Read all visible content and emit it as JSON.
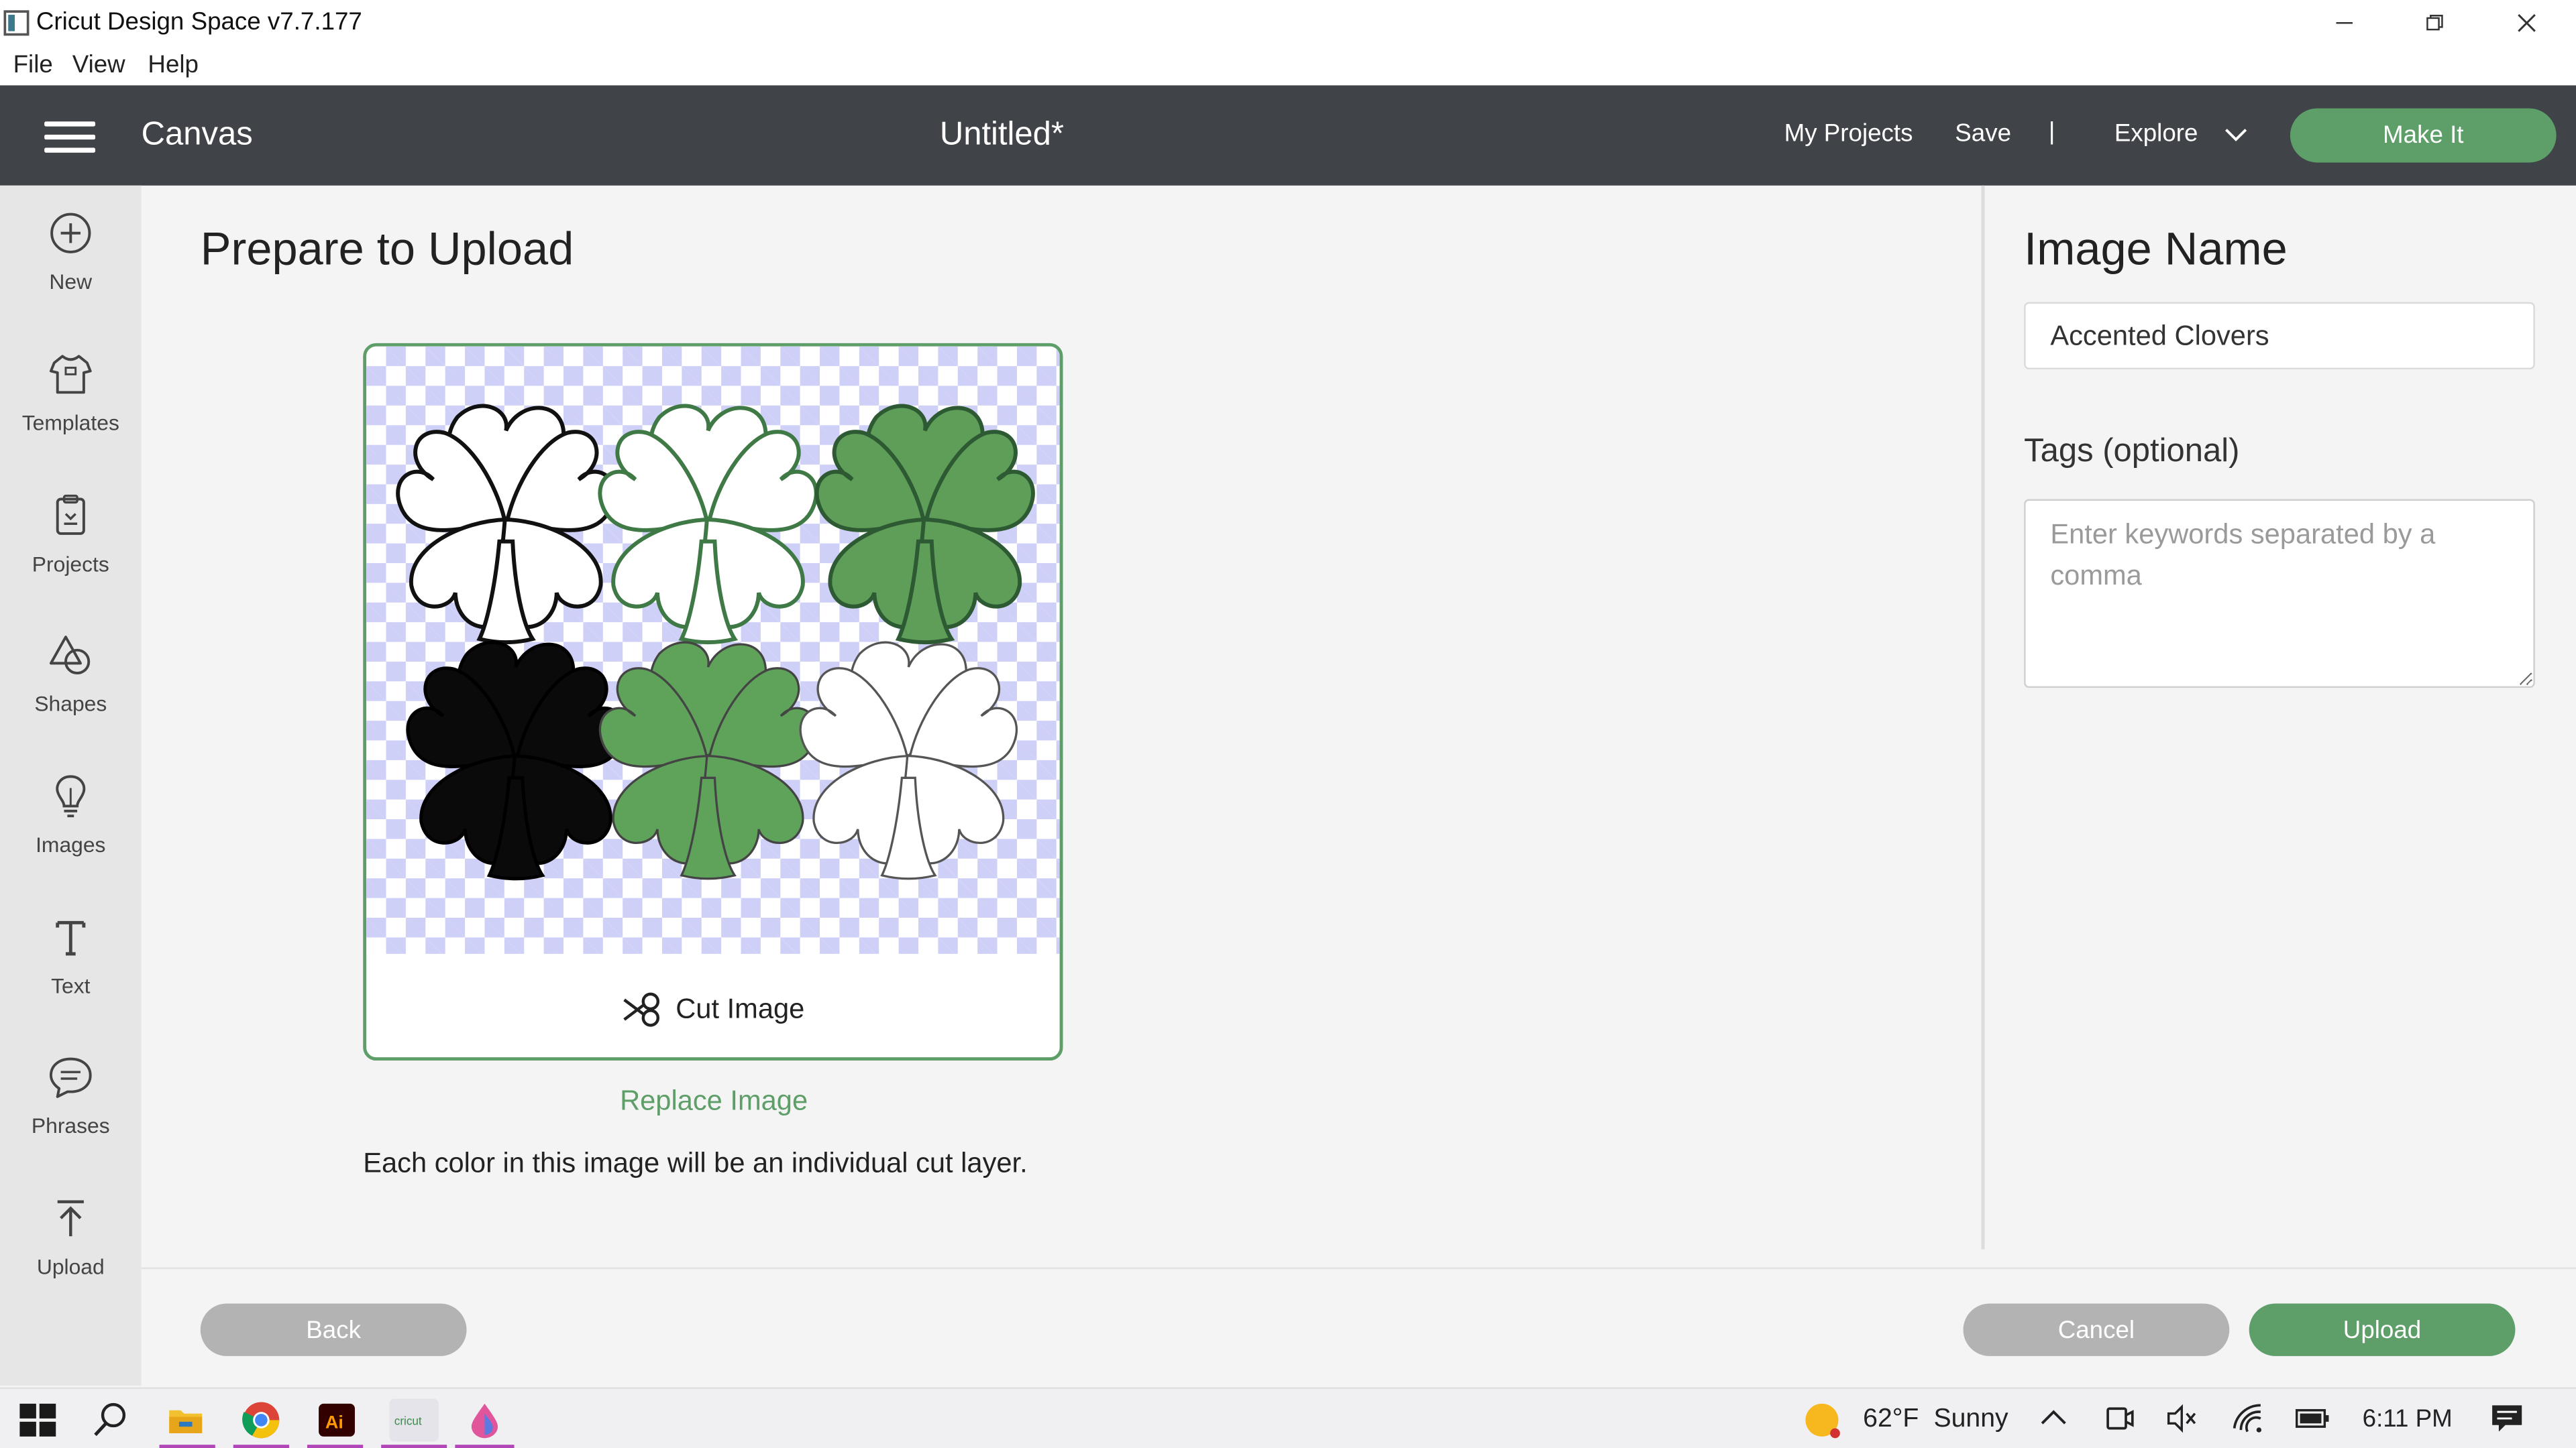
{
  "window": {
    "app_title": "Cricut Design Space  v7.7.177"
  },
  "menu": [
    "File",
    "View",
    "Help"
  ],
  "header": {
    "canvas_label": "Canvas",
    "doc_title": "Untitled*",
    "my_projects": "My Projects",
    "save": "Save",
    "separator": "|",
    "explore": "Explore",
    "make_it": "Make It"
  },
  "sidebar": {
    "items": [
      {
        "label": "New",
        "icon": "plus-circle-icon"
      },
      {
        "label": "Templates",
        "icon": "tshirt-icon"
      },
      {
        "label": "Projects",
        "icon": "projects-icon"
      },
      {
        "label": "Shapes",
        "icon": "shapes-icon"
      },
      {
        "label": "Images",
        "icon": "lightbulb-icon"
      },
      {
        "label": "Text",
        "icon": "text-icon"
      },
      {
        "label": "Phrases",
        "icon": "speech-bubble-icon"
      },
      {
        "label": "Upload",
        "icon": "upload-icon"
      }
    ]
  },
  "main": {
    "title": "Prepare to Upload",
    "cut_image_label": "Cut Image",
    "replace_image": "Replace Image",
    "info_text": "Each color in this image will be an individual cut layer.",
    "preview_clovers": [
      {
        "style": "outline-black"
      },
      {
        "style": "outline-green"
      },
      {
        "style": "filled-green-half"
      },
      {
        "style": "filled-black-half"
      },
      {
        "style": "filled-green-light"
      },
      {
        "style": "white-half"
      }
    ]
  },
  "right_panel": {
    "image_name_title": "Image Name",
    "image_name_value": "Accented Clovers",
    "tags_title": "Tags (optional)",
    "tags_placeholder": "Enter keywords separated by a comma",
    "tags_value": ""
  },
  "footer": {
    "back": "Back",
    "cancel": "Cancel",
    "upload": "Upload"
  },
  "taskbar": {
    "weather_temp": "62°F",
    "weather_desc": "Sunny",
    "time": "6:11 PM"
  },
  "colors": {
    "accent_green": "#5e9e68",
    "header_bg": "#404347",
    "sidebar_bg": "#e6e6e6",
    "button_gray": "#b3b3b3",
    "checker_blue": "#cfd0f7"
  }
}
